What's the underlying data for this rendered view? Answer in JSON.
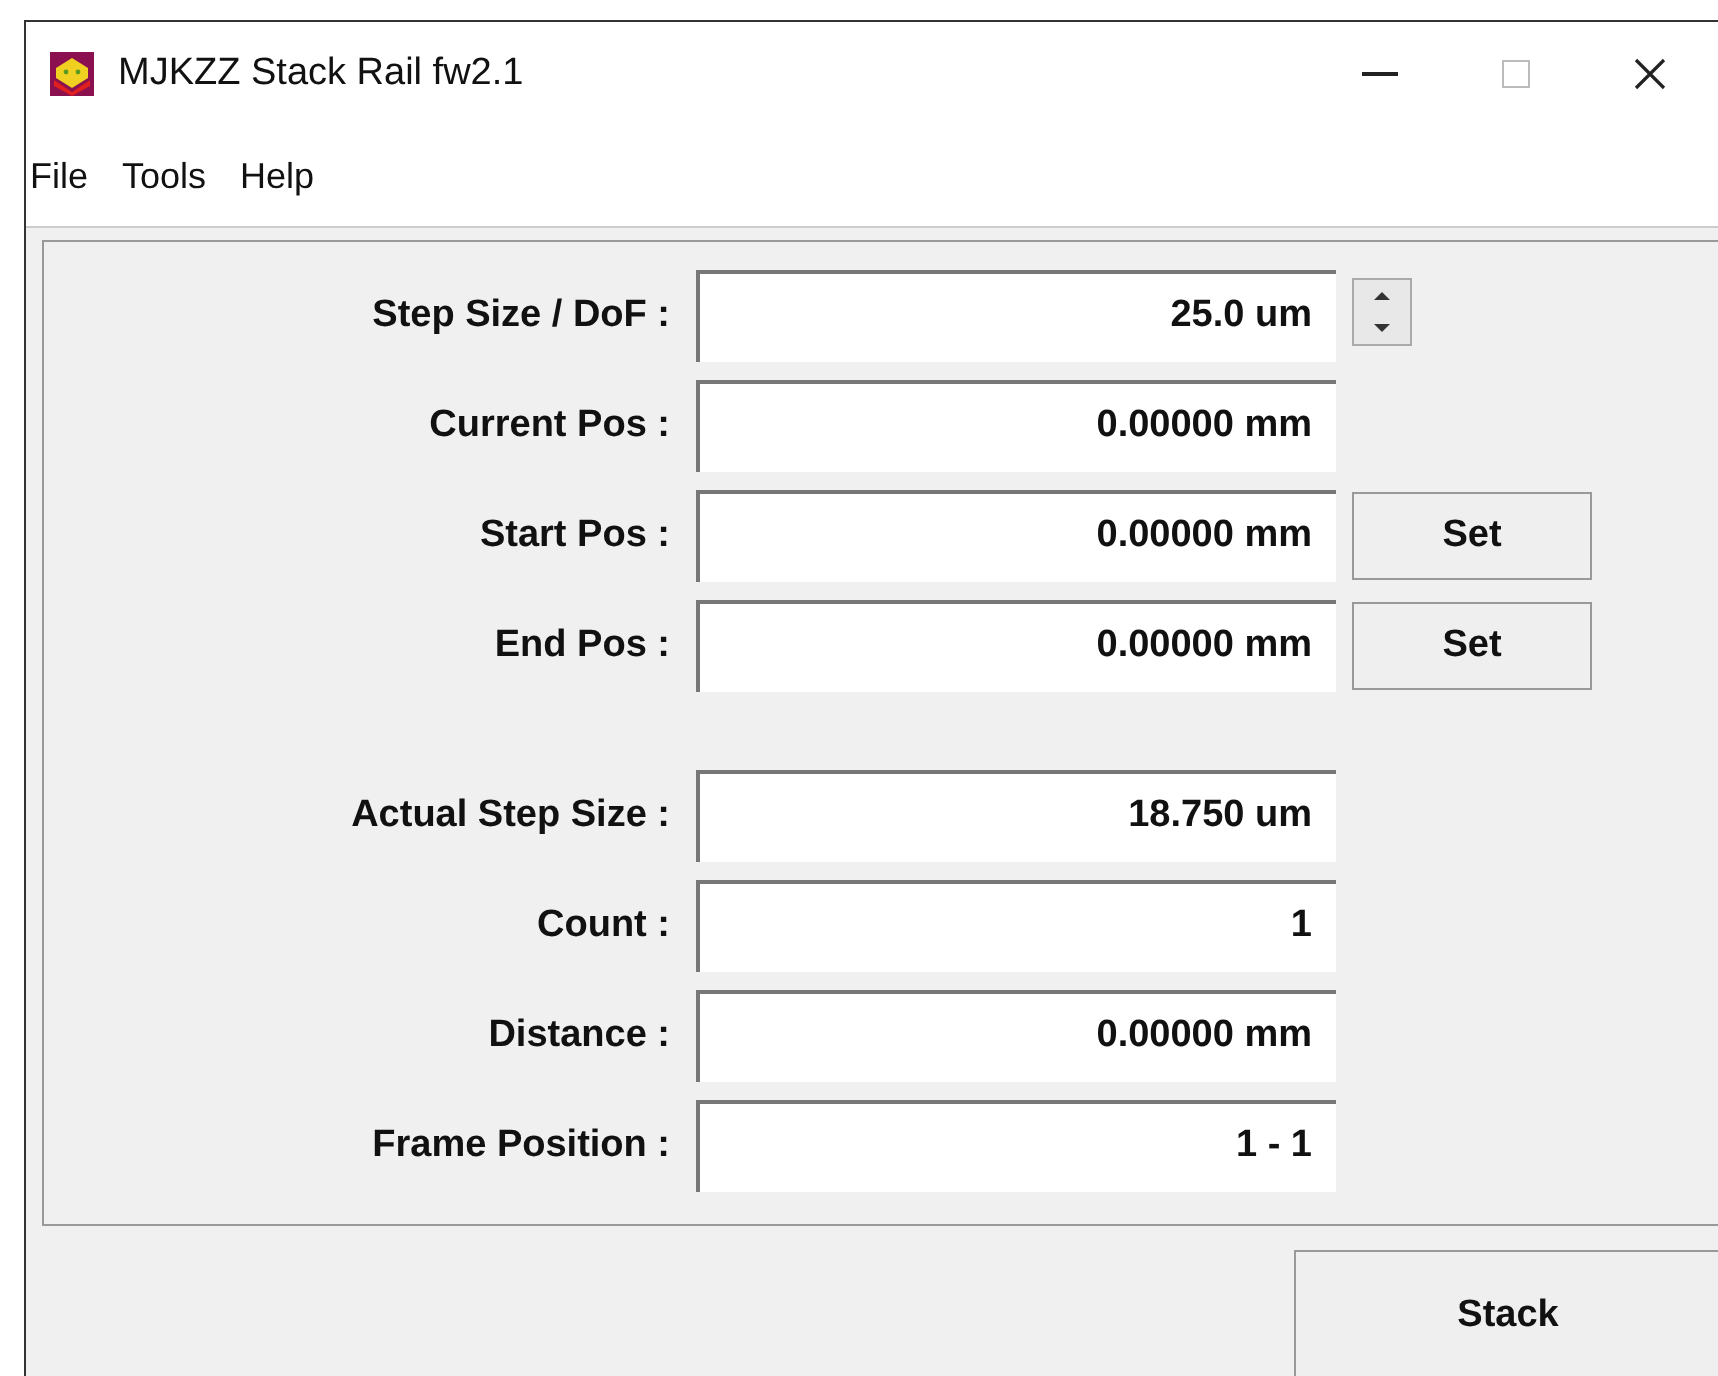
{
  "window": {
    "title": "MJKZZ Stack Rail fw2.1"
  },
  "menu": [
    "File",
    "Tools",
    "Help"
  ],
  "groups": [
    [
      {
        "label": "Step Size / DoF :",
        "value": "25.0 um",
        "kind": "spinner"
      },
      {
        "label": "Current Pos :",
        "value": "0.00000 mm",
        "kind": "plain"
      },
      {
        "label": "Start Pos :",
        "value": "0.00000 mm",
        "kind": "set",
        "button": "Set"
      },
      {
        "label": "End Pos :",
        "value": "0.00000 mm",
        "kind": "set",
        "button": "Set"
      }
    ],
    [
      {
        "label": "Actual Step Size :",
        "value": "18.750 um",
        "kind": "plain"
      },
      {
        "label": "Count :",
        "value": "1",
        "kind": "plain"
      },
      {
        "label": "Distance :",
        "value": "0.00000 mm",
        "kind": "plain"
      },
      {
        "label": "Frame Position :",
        "value": "1 - 1",
        "kind": "plain"
      }
    ]
  ],
  "stack_button": "Stack"
}
